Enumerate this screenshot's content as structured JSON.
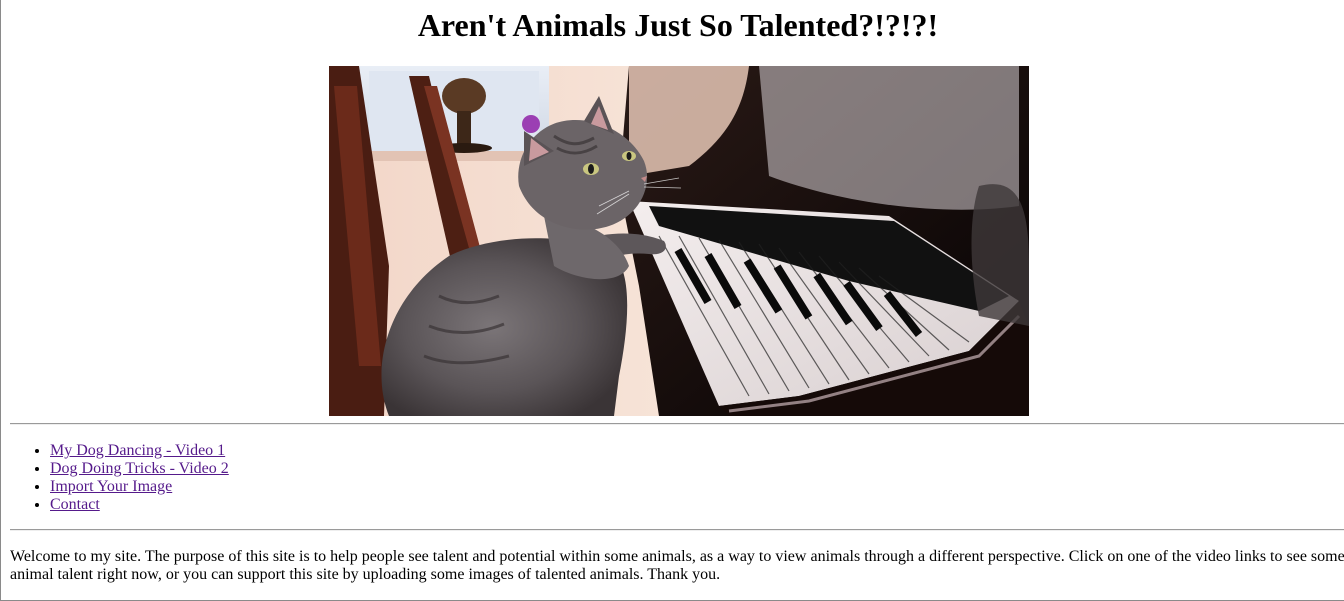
{
  "page": {
    "title": "Aren't Animals Just So Talented?!?!?!"
  },
  "hero_image": {
    "subject": "cat playing piano"
  },
  "nav": {
    "links": [
      {
        "label": "My Dog Dancing - Video 1"
      },
      {
        "label": "Dog Doing Tricks - Video 2"
      },
      {
        "label": "Import Your Image"
      },
      {
        "label": "Contact"
      }
    ]
  },
  "intro": {
    "line1": "Welcome to my site. The purpose of this site is to help people see talent and potential within some animals, as a way to view animals through a different perspective. Click on one of the video links to see some",
    "line2": "animal talent right now, or you can support this site by uploading some images of talented animals. Thank you."
  },
  "colors": {
    "link_visited": "#551a8b",
    "rule": "#9a9a9a"
  }
}
